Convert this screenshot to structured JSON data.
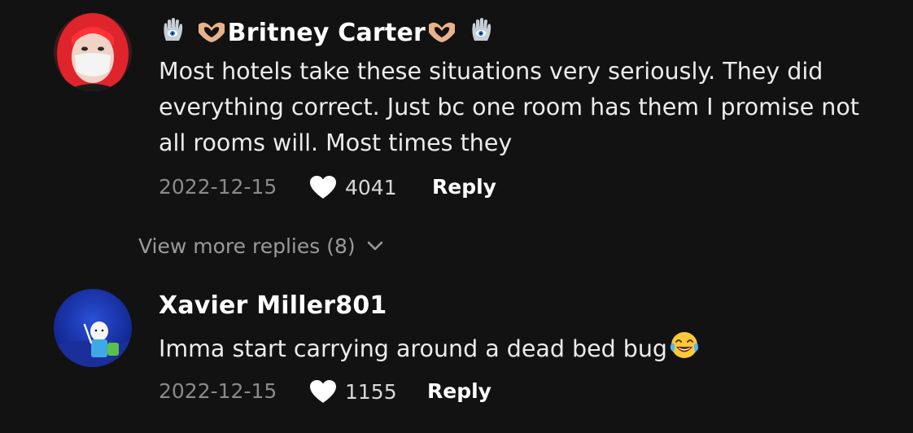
{
  "comments": [
    {
      "username": "Britney Carter",
      "text": "Most hotels take these situations very seriously. They did everything correct. Just bc one room has them I promise not all rooms will. Most times they",
      "date": "2022-12-15",
      "likes": "4041",
      "reply_label": "Reply",
      "avatar_icon": "profile-photo-red-hair-mask",
      "name_decoration_icons": [
        "hamsa-icon",
        "heart-hands-icon"
      ]
    },
    {
      "username": "Xavier Miller801",
      "text": "Imma start carrying around a dead bed bug",
      "text_emoji_icon": "laughing-crying-emoji",
      "date": "2022-12-15",
      "likes": "1155",
      "reply_label": "Reply",
      "avatar_icon": "cartoon-character-avatar"
    }
  ],
  "view_more_replies": "View more replies (8)",
  "colors": {
    "background": "#121212",
    "text_primary": "#ffffff",
    "text_secondary": "#8a8a8a"
  }
}
